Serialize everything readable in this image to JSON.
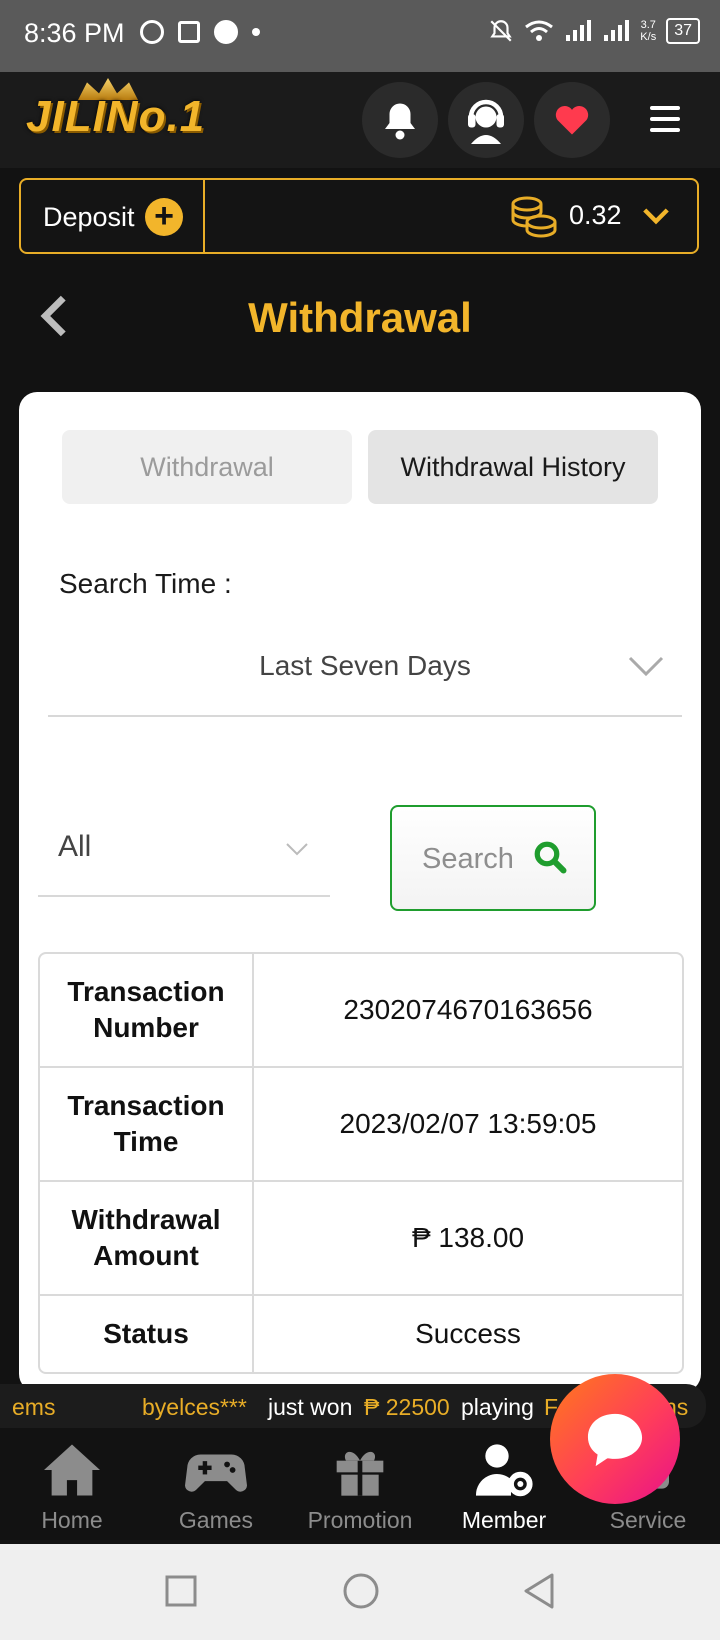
{
  "status_bar": {
    "time": "8:36 PM",
    "speed_top": "3.7",
    "speed_bottom": "K/s",
    "battery": "37"
  },
  "header": {
    "logo_text": "JILINo.1",
    "icons": [
      "bell-icon",
      "support-agent-icon",
      "heart-icon",
      "menu-icon"
    ]
  },
  "wallet": {
    "deposit_label": "Deposit",
    "balance": "0.32"
  },
  "page": {
    "title": "Withdrawal"
  },
  "tabs": [
    {
      "label": "Withdrawal",
      "active": false
    },
    {
      "label": "Withdrawal History",
      "active": true
    }
  ],
  "filters": {
    "search_time_label": "Search Time :",
    "period_value": "Last Seven Days",
    "type_value": "All",
    "search_button": "Search"
  },
  "transaction": [
    {
      "key": "Transaction Number",
      "value": "2302074670163656"
    },
    {
      "key": "Transaction Time",
      "value": "2023/02/07 13:59:05"
    },
    {
      "key": "Withdrawal Amount",
      "value": "₱ 138.00"
    },
    {
      "key": "Status",
      "value": "Success"
    }
  ],
  "ticker": {
    "fragment_left": "ems",
    "user": "byelces***",
    "text_won": "just won",
    "amount": "₱ 22500",
    "text_playing": "playing",
    "game_fragment_a": "Fo",
    "game_fragment_b": "ns"
  },
  "bottom_nav": [
    {
      "label": "Home",
      "icon": "home-icon",
      "active": false
    },
    {
      "label": "Games",
      "icon": "gamepad-icon",
      "active": false
    },
    {
      "label": "Promotion",
      "icon": "gift-icon",
      "active": false
    },
    {
      "label": "Member",
      "icon": "member-settings-icon",
      "active": true
    },
    {
      "label": "Service",
      "icon": "service-icon",
      "active": false
    }
  ],
  "colors": {
    "accent_gold": "#f2b52b",
    "search_green": "#1f9d2e",
    "chat_gradient_start": "#ff7a1a",
    "chat_gradient_end": "#e8108a"
  }
}
